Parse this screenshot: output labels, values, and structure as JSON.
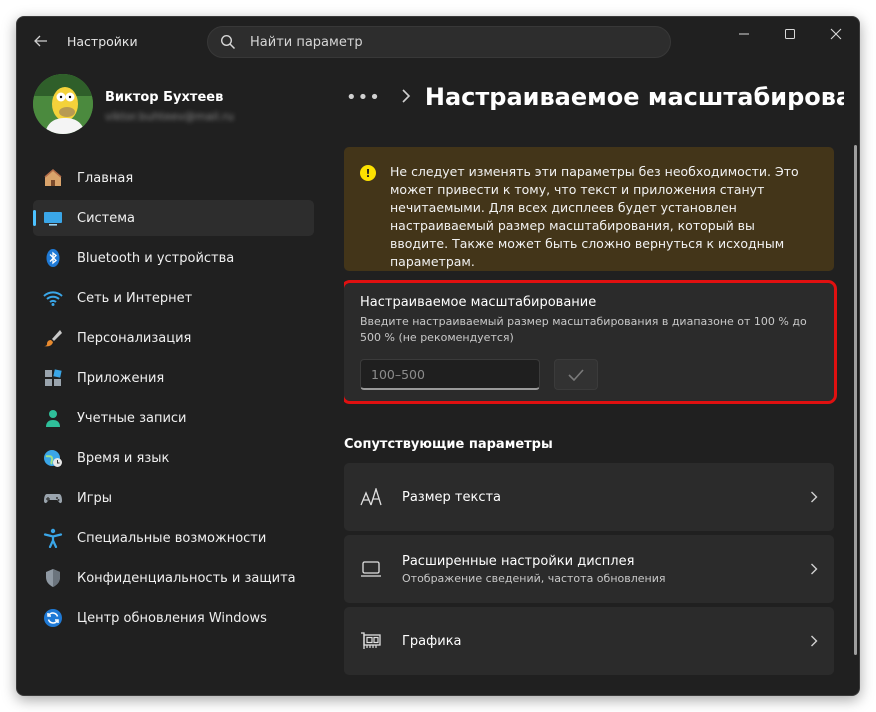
{
  "window": {
    "app_title": "Настройки",
    "search_placeholder": "Найти параметр"
  },
  "profile": {
    "name": "Виктор Бухтеев",
    "email": "viktor.buhteev@mail.ru"
  },
  "sidebar": {
    "items": [
      {
        "label": "Главная",
        "icon": "home-icon"
      },
      {
        "label": "Система",
        "icon": "display-icon",
        "selected": true
      },
      {
        "label": "Bluetooth и устройства",
        "icon": "bluetooth-icon"
      },
      {
        "label": "Сеть и Интернет",
        "icon": "wifi-icon"
      },
      {
        "label": "Персонализация",
        "icon": "brush-icon"
      },
      {
        "label": "Приложения",
        "icon": "apps-icon"
      },
      {
        "label": "Учетные записи",
        "icon": "person-icon"
      },
      {
        "label": "Время и язык",
        "icon": "globe-clock-icon"
      },
      {
        "label": "Игры",
        "icon": "gamepad-icon"
      },
      {
        "label": "Специальные возможности",
        "icon": "accessibility-icon"
      },
      {
        "label": "Конфиденциальность и защита",
        "icon": "shield-icon"
      },
      {
        "label": "Центр обновления Windows",
        "icon": "update-icon"
      }
    ]
  },
  "content": {
    "breadcrumb_more": "•••",
    "page_title": "Настраиваемое масштабирован",
    "warning": "Не следует изменять эти параметры без необходимости. Это может привести к тому, что текст и приложения станут нечитаемыми. Для всех дисплеев будет установлен настраиваемый размер масштабирования, который вы вводите. Также может быть сложно вернуться к исходным параметрам.",
    "scale_card": {
      "title": "Настраиваемое масштабирование",
      "description": "Введите настраиваемый размер масштабирования в диапазоне от 100 % до 500 % (не рекомендуется)",
      "placeholder": "100–500"
    },
    "related_title": "Сопутствующие параметры",
    "related": [
      {
        "title": "Размер текста",
        "subtitle": "",
        "icon": "text-size-icon"
      },
      {
        "title": "Расширенные настройки дисплея",
        "subtitle": "Отображение сведений, частота обновления",
        "icon": "monitor-icon"
      },
      {
        "title": "Графика",
        "subtitle": "",
        "icon": "graphics-card-icon"
      }
    ]
  },
  "colors": {
    "accent": "#4cc2ff",
    "warning_bg": "#433519",
    "warning_icon": "#fce100",
    "highlight": "#e01010"
  }
}
